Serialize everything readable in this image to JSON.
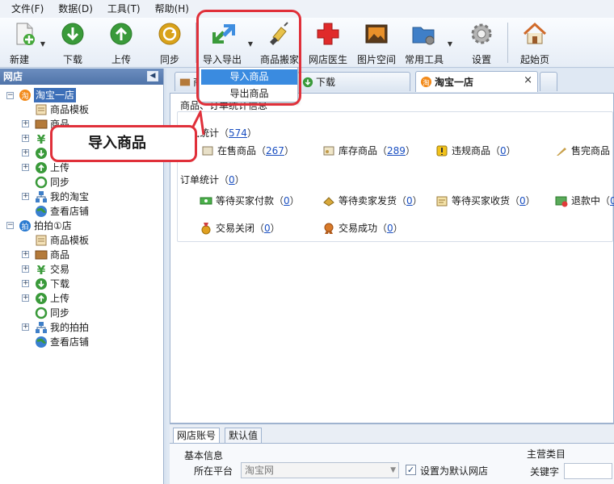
{
  "menu": [
    "文件(F)",
    "数据(D)",
    "工具(T)",
    "帮助(H)"
  ],
  "toolbar": {
    "new": "新建",
    "download": "下载",
    "upload": "上传",
    "sync": "同步",
    "import_export": "导入导出",
    "move_goods": "商品搬家",
    "shop_doctor": "网店医生",
    "image_space": "图片空间",
    "common_tools": "常用工具",
    "settings": "设置",
    "start_page": "起始页"
  },
  "dropdown": {
    "import": "导入商品",
    "export": "导出商品"
  },
  "callout": "导入商品",
  "left_panel": {
    "title": "网店",
    "pin": "◀",
    "shop1": {
      "name": "淘宝一店",
      "children": [
        "商品模板",
        "商品",
        "交易",
        "下载",
        "上传",
        "同步",
        "我的淘宝",
        "查看店铺"
      ]
    },
    "shop2": {
      "name": "拍拍①店",
      "children": [
        "商品模板",
        "商品",
        "交易",
        "下载",
        "上传",
        "同步",
        "我的拍拍",
        "查看店铺"
      ]
    }
  },
  "tabs": {
    "tab1": "商",
    "tab2": "下载",
    "tab3": "淘宝一店",
    "close": "×"
  },
  "content": {
    "section_title": "商品、订单统计信息",
    "goods_stats": {
      "label": "商品统计",
      "count": "574"
    },
    "on_sale": {
      "label": "在售商品",
      "count": "267"
    },
    "in_stock": {
      "label": "库存商品",
      "count": "289"
    },
    "violation": {
      "label": "违规商品",
      "count": "0"
    },
    "sold_out": {
      "label": "售完商品",
      "count": "0"
    },
    "order_stats": {
      "label": "订单统计",
      "count": "0"
    },
    "wait_pay": {
      "label": "等待买家付款",
      "count": "0"
    },
    "wait_ship": {
      "label": "等待卖家发货",
      "count": "0"
    },
    "wait_receive": {
      "label": "等待买家收货",
      "count": "0"
    },
    "refund": {
      "label": "退款中",
      "count": "0"
    },
    "closed": {
      "label": "交易关闭",
      "count": "0"
    },
    "success": {
      "label": "交易成功",
      "count": "0"
    }
  },
  "bottom": {
    "tab_account": "网店账号",
    "tab_default": "默认值",
    "basic_info": "基本信息",
    "platform_label": "所在平台",
    "platform_value": "淘宝网",
    "default_shop": "设置为默认网店",
    "main_category": "主营类目",
    "keyword": "关键字"
  },
  "colors": {
    "highlight": "#e0303a",
    "selection": "#3d6fb8",
    "link": "#1a4fc1"
  }
}
